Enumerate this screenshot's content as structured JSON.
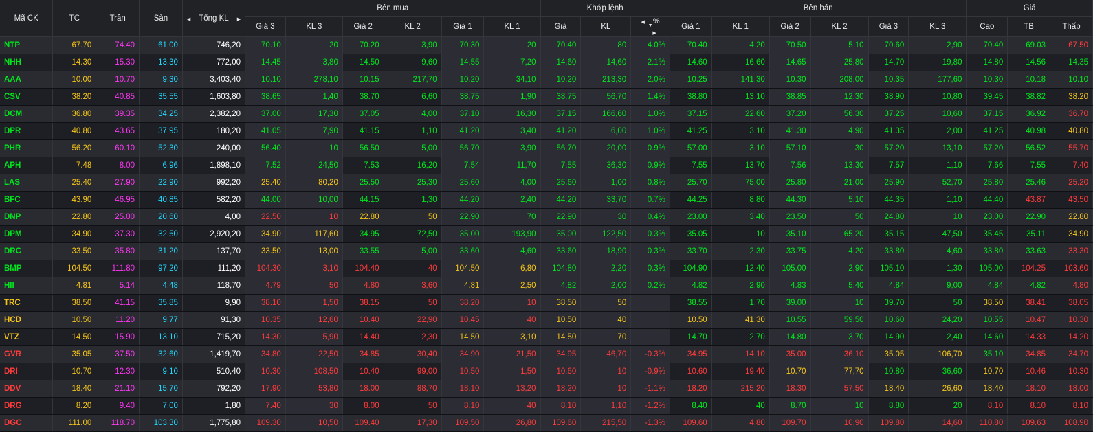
{
  "header": {
    "symbol": "Mã CK",
    "tc": "TC",
    "tran": "Trần",
    "san": "Sàn",
    "tongkl": "Tổng KL",
    "group_buy": "Bên mua",
    "group_match": "Khớp lệnh",
    "group_sell": "Bên bán",
    "group_price": "Giá",
    "buy_cols": [
      "Giá 3",
      "KL 3",
      "Giá 2",
      "KL 2",
      "Giá 1",
      "KL 1"
    ],
    "match_cols": [
      "Giá",
      "KL",
      "%"
    ],
    "sell_cols": [
      "Giá 1",
      "KL 1",
      "Giá 2",
      "KL 2",
      "Giá 3",
      "KL 3"
    ],
    "price_cols": [
      "Cao",
      "TB",
      "Thấp"
    ]
  },
  "colors": {
    "up": "#00e61e",
    "down": "#ff3b3b",
    "ref": "#f5c518",
    "ceil": "#ff37f5",
    "floor": "#1fd8ff"
  },
  "rows": [
    {
      "sym": "NTP",
      "s": "g",
      "tc": "67.70",
      "tran": "74.40",
      "san": "61.00",
      "kl": "746,20",
      "b3": [
        "70.10",
        "20",
        "g"
      ],
      "b2": [
        "70.20",
        "3,90",
        "g"
      ],
      "b1": [
        "70.30",
        "20",
        "g"
      ],
      "m": [
        "70.40",
        "80",
        "4.0%",
        "g"
      ],
      "s1": [
        "70.40",
        "4,20",
        "g"
      ],
      "s2": [
        "70.50",
        "5,10",
        "g"
      ],
      "s3": [
        "70.60",
        "2,90",
        "g"
      ],
      "hi": [
        "70.40",
        "g"
      ],
      "tb": [
        "69.03",
        "g"
      ],
      "lo": [
        "67.50",
        "r"
      ]
    },
    {
      "sym": "NHH",
      "s": "g",
      "tc": "14.30",
      "tran": "15.30",
      "san": "13.30",
      "kl": "772,00",
      "b3": [
        "14.45",
        "3,80",
        "g"
      ],
      "b2": [
        "14.50",
        "9,60",
        "g"
      ],
      "b1": [
        "14.55",
        "7,20",
        "g"
      ],
      "m": [
        "14.60",
        "14,60",
        "2.1%",
        "g"
      ],
      "s1": [
        "14.60",
        "16,60",
        "g"
      ],
      "s2": [
        "14.65",
        "25,80",
        "g"
      ],
      "s3": [
        "14.70",
        "19,80",
        "g"
      ],
      "hi": [
        "14.80",
        "g"
      ],
      "tb": [
        "14.56",
        "g"
      ],
      "lo": [
        "14.35",
        "g"
      ]
    },
    {
      "sym": "AAA",
      "s": "g",
      "tc": "10.00",
      "tran": "10.70",
      "san": "9.30",
      "kl": "3,403,40",
      "b3": [
        "10.10",
        "278,10",
        "g"
      ],
      "b2": [
        "10.15",
        "217,70",
        "g"
      ],
      "b1": [
        "10.20",
        "34,10",
        "g"
      ],
      "m": [
        "10.20",
        "213,30",
        "2.0%",
        "g"
      ],
      "s1": [
        "10.25",
        "141,30",
        "g"
      ],
      "s2": [
        "10.30",
        "208,00",
        "g"
      ],
      "s3": [
        "10.35",
        "177,60",
        "g"
      ],
      "hi": [
        "10.30",
        "g"
      ],
      "tb": [
        "10.18",
        "g"
      ],
      "lo": [
        "10.10",
        "g"
      ]
    },
    {
      "sym": "CSV",
      "s": "g",
      "tc": "38.20",
      "tran": "40.85",
      "san": "35.55",
      "kl": "1,603,80",
      "b3": [
        "38.65",
        "1,40",
        "g"
      ],
      "b2": [
        "38.70",
        "6,60",
        "g"
      ],
      "b1": [
        "38.75",
        "1,90",
        "g"
      ],
      "m": [
        "38.75",
        "56,70",
        "1.4%",
        "g"
      ],
      "s1": [
        "38.80",
        "13,10",
        "g"
      ],
      "s2": [
        "38.85",
        "12,30",
        "g"
      ],
      "s3": [
        "38.90",
        "10,80",
        "g"
      ],
      "hi": [
        "39.45",
        "g"
      ],
      "tb": [
        "38.82",
        "g"
      ],
      "lo": [
        "38.20",
        "y"
      ]
    },
    {
      "sym": "DCM",
      "s": "g",
      "tc": "36.80",
      "tran": "39.35",
      "san": "34.25",
      "kl": "2,382,20",
      "b3": [
        "37.00",
        "17,30",
        "g"
      ],
      "b2": [
        "37.05",
        "4,00",
        "g"
      ],
      "b1": [
        "37.10",
        "16,30",
        "g"
      ],
      "m": [
        "37.15",
        "166,60",
        "1.0%",
        "g"
      ],
      "s1": [
        "37.15",
        "22,60",
        "g"
      ],
      "s2": [
        "37.20",
        "56,30",
        "g"
      ],
      "s3": [
        "37.25",
        "10,60",
        "g"
      ],
      "hi": [
        "37.15",
        "g"
      ],
      "tb": [
        "36.92",
        "g"
      ],
      "lo": [
        "36.70",
        "r"
      ]
    },
    {
      "sym": "DPR",
      "s": "g",
      "tc": "40.80",
      "tran": "43.65",
      "san": "37.95",
      "kl": "180,20",
      "b3": [
        "41.05",
        "7,90",
        "g"
      ],
      "b2": [
        "41.15",
        "1,10",
        "g"
      ],
      "b1": [
        "41.20",
        "3,40",
        "g"
      ],
      "m": [
        "41.20",
        "6,00",
        "1.0%",
        "g"
      ],
      "s1": [
        "41.25",
        "3,10",
        "g"
      ],
      "s2": [
        "41.30",
        "4,90",
        "g"
      ],
      "s3": [
        "41.35",
        "2,00",
        "g"
      ],
      "hi": [
        "41.25",
        "g"
      ],
      "tb": [
        "40.98",
        "g"
      ],
      "lo": [
        "40.80",
        "y"
      ]
    },
    {
      "sym": "PHR",
      "s": "g",
      "tc": "56.20",
      "tran": "60.10",
      "san": "52.30",
      "kl": "240,00",
      "b3": [
        "56.40",
        "10",
        "g"
      ],
      "b2": [
        "56.50",
        "5,00",
        "g"
      ],
      "b1": [
        "56.70",
        "3,90",
        "g"
      ],
      "m": [
        "56.70",
        "20,00",
        "0.9%",
        "g"
      ],
      "s1": [
        "57.00",
        "3,10",
        "g"
      ],
      "s2": [
        "57.10",
        "30",
        "g"
      ],
      "s3": [
        "57.20",
        "13,10",
        "g"
      ],
      "hi": [
        "57.20",
        "g"
      ],
      "tb": [
        "56.52",
        "g"
      ],
      "lo": [
        "55.70",
        "r"
      ]
    },
    {
      "sym": "APH",
      "s": "g",
      "tc": "7.48",
      "tran": "8.00",
      "san": "6.96",
      "kl": "1,898,10",
      "b3": [
        "7.52",
        "24,50",
        "g"
      ],
      "b2": [
        "7.53",
        "16,20",
        "g"
      ],
      "b1": [
        "7.54",
        "11,70",
        "g"
      ],
      "m": [
        "7.55",
        "36,30",
        "0.9%",
        "g"
      ],
      "s1": [
        "7.55",
        "13,70",
        "g"
      ],
      "s2": [
        "7.56",
        "13,30",
        "g"
      ],
      "s3": [
        "7.57",
        "1,10",
        "g"
      ],
      "hi": [
        "7.66",
        "g"
      ],
      "tb": [
        "7.55",
        "g"
      ],
      "lo": [
        "7.40",
        "r"
      ]
    },
    {
      "sym": "LAS",
      "s": "g",
      "tc": "25.40",
      "tran": "27.90",
      "san": "22.90",
      "kl": "992,20",
      "b3": [
        "25.40",
        "80,20",
        "y"
      ],
      "b2": [
        "25.50",
        "25,30",
        "g"
      ],
      "b1": [
        "25.60",
        "4,00",
        "g"
      ],
      "m": [
        "25.60",
        "1,00",
        "0.8%",
        "g"
      ],
      "s1": [
        "25.70",
        "75,00",
        "g"
      ],
      "s2": [
        "25.80",
        "21,00",
        "g"
      ],
      "s3": [
        "25.90",
        "52,70",
        "g"
      ],
      "hi": [
        "25.80",
        "g"
      ],
      "tb": [
        "25.46",
        "g"
      ],
      "lo": [
        "25.20",
        "r"
      ]
    },
    {
      "sym": "BFC",
      "s": "g",
      "tc": "43.90",
      "tran": "46.95",
      "san": "40.85",
      "kl": "582,20",
      "b3": [
        "44.00",
        "10,00",
        "g"
      ],
      "b2": [
        "44.15",
        "1,30",
        "g"
      ],
      "b1": [
        "44.20",
        "2,40",
        "g"
      ],
      "m": [
        "44.20",
        "33,70",
        "0.7%",
        "g"
      ],
      "s1": [
        "44.25",
        "8,80",
        "g"
      ],
      "s2": [
        "44.30",
        "5,10",
        "g"
      ],
      "s3": [
        "44.35",
        "1,10",
        "g"
      ],
      "hi": [
        "44.40",
        "g"
      ],
      "tb": [
        "43.87",
        "r"
      ],
      "lo": [
        "43.50",
        "r"
      ]
    },
    {
      "sym": "DNP",
      "s": "g",
      "tc": "22.80",
      "tran": "25.00",
      "san": "20.60",
      "kl": "4,00",
      "b3": [
        "22.50",
        "10",
        "r"
      ],
      "b2": [
        "22.80",
        "50",
        "y"
      ],
      "b1": [
        "22.90",
        "70",
        "g"
      ],
      "m": [
        "22.90",
        "30",
        "0.4%",
        "g"
      ],
      "s1": [
        "23.00",
        "3,40",
        "g"
      ],
      "s2": [
        "23.50",
        "50",
        "g"
      ],
      "s3": [
        "24.80",
        "10",
        "g"
      ],
      "hi": [
        "23.00",
        "g"
      ],
      "tb": [
        "22.90",
        "g"
      ],
      "lo": [
        "22.80",
        "y"
      ]
    },
    {
      "sym": "DPM",
      "s": "g",
      "tc": "34.90",
      "tran": "37.30",
      "san": "32.50",
      "kl": "2,920,20",
      "b3": [
        "34.90",
        "117,60",
        "y"
      ],
      "b2": [
        "34.95",
        "72,50",
        "g"
      ],
      "b1": [
        "35.00",
        "193,90",
        "g"
      ],
      "m": [
        "35.00",
        "122,50",
        "0.3%",
        "g"
      ],
      "s1": [
        "35.05",
        "10",
        "g"
      ],
      "s2": [
        "35.10",
        "65,20",
        "g"
      ],
      "s3": [
        "35.15",
        "47,50",
        "g"
      ],
      "hi": [
        "35.45",
        "g"
      ],
      "tb": [
        "35.11",
        "g"
      ],
      "lo": [
        "34.90",
        "y"
      ]
    },
    {
      "sym": "DRC",
      "s": "g",
      "tc": "33.50",
      "tran": "35.80",
      "san": "31.20",
      "kl": "137,70",
      "b3": [
        "33.50",
        "13,00",
        "y"
      ],
      "b2": [
        "33.55",
        "5,00",
        "g"
      ],
      "b1": [
        "33.60",
        "4,60",
        "g"
      ],
      "m": [
        "33.60",
        "18,90",
        "0.3%",
        "g"
      ],
      "s1": [
        "33.70",
        "2,30",
        "g"
      ],
      "s2": [
        "33.75",
        "4,20",
        "g"
      ],
      "s3": [
        "33.80",
        "4,60",
        "g"
      ],
      "hi": [
        "33.80",
        "g"
      ],
      "tb": [
        "33.63",
        "g"
      ],
      "lo": [
        "33.30",
        "r"
      ]
    },
    {
      "sym": "BMP",
      "s": "g",
      "tc": "104.50",
      "tran": "111.80",
      "san": "97.20",
      "kl": "111,20",
      "b3": [
        "104.30",
        "3,10",
        "r"
      ],
      "b2": [
        "104.40",
        "40",
        "r"
      ],
      "b1": [
        "104.50",
        "6,80",
        "y"
      ],
      "m": [
        "104.80",
        "2,20",
        "0.3%",
        "g"
      ],
      "s1": [
        "104.90",
        "12,40",
        "g"
      ],
      "s2": [
        "105.00",
        "2,90",
        "g"
      ],
      "s3": [
        "105.10",
        "1,30",
        "g"
      ],
      "hi": [
        "105.00",
        "g"
      ],
      "tb": [
        "104.25",
        "r"
      ],
      "lo": [
        "103.60",
        "r"
      ]
    },
    {
      "sym": "HII",
      "s": "g",
      "tc": "4.81",
      "tran": "5.14",
      "san": "4.48",
      "kl": "118,70",
      "b3": [
        "4.79",
        "50",
        "r"
      ],
      "b2": [
        "4.80",
        "3,60",
        "r"
      ],
      "b1": [
        "4.81",
        "2,50",
        "y"
      ],
      "m": [
        "4.82",
        "2,00",
        "0.2%",
        "g"
      ],
      "s1": [
        "4.82",
        "2,90",
        "g"
      ],
      "s2": [
        "4.83",
        "5,40",
        "g"
      ],
      "s3": [
        "4.84",
        "9,00",
        "g"
      ],
      "hi": [
        "4.84",
        "g"
      ],
      "tb": [
        "4.82",
        "g"
      ],
      "lo": [
        "4.80",
        "r"
      ]
    },
    {
      "sym": "TRC",
      "s": "y",
      "tc": "38.50",
      "tran": "41.15",
      "san": "35.85",
      "kl": "9,90",
      "b3": [
        "38.10",
        "1,50",
        "r"
      ],
      "b2": [
        "38.15",
        "50",
        "r"
      ],
      "b1": [
        "38.20",
        "10",
        "r"
      ],
      "m": [
        "38.50",
        "50",
        "",
        "y"
      ],
      "s1": [
        "38.55",
        "1,70",
        "g"
      ],
      "s2": [
        "39.00",
        "10",
        "g"
      ],
      "s3": [
        "39.70",
        "50",
        "g"
      ],
      "hi": [
        "38.50",
        "y"
      ],
      "tb": [
        "38.41",
        "r"
      ],
      "lo": [
        "38.05",
        "r"
      ]
    },
    {
      "sym": "HCD",
      "s": "y",
      "tc": "10.50",
      "tran": "11.20",
      "san": "9.77",
      "kl": "91,30",
      "b3": [
        "10.35",
        "12,60",
        "r"
      ],
      "b2": [
        "10.40",
        "22,90",
        "r"
      ],
      "b1": [
        "10.45",
        "40",
        "r"
      ],
      "m": [
        "10.50",
        "40",
        "",
        "y"
      ],
      "s1": [
        "10.50",
        "41,30",
        "y"
      ],
      "s2": [
        "10.55",
        "59,50",
        "g"
      ],
      "s3": [
        "10.60",
        "24,20",
        "g"
      ],
      "hi": [
        "10.55",
        "g"
      ],
      "tb": [
        "10.47",
        "r"
      ],
      "lo": [
        "10.30",
        "r"
      ]
    },
    {
      "sym": "VTZ",
      "s": "y",
      "tc": "14.50",
      "tran": "15.90",
      "san": "13.10",
      "kl": "715,20",
      "b3": [
        "14.30",
        "5,90",
        "r"
      ],
      "b2": [
        "14.40",
        "2,30",
        "r"
      ],
      "b1": [
        "14.50",
        "3,10",
        "y"
      ],
      "m": [
        "14.50",
        "70",
        "",
        "y"
      ],
      "s1": [
        "14.70",
        "2,70",
        "g"
      ],
      "s2": [
        "14.80",
        "3,70",
        "g"
      ],
      "s3": [
        "14.90",
        "2,40",
        "g"
      ],
      "hi": [
        "14.60",
        "g"
      ],
      "tb": [
        "14.33",
        "r"
      ],
      "lo": [
        "14.20",
        "r"
      ]
    },
    {
      "sym": "GVR",
      "s": "r",
      "tc": "35.05",
      "tran": "37.50",
      "san": "32.60",
      "kl": "1,419,70",
      "b3": [
        "34.80",
        "22,50",
        "r"
      ],
      "b2": [
        "34.85",
        "30,40",
        "r"
      ],
      "b1": [
        "34.90",
        "21,50",
        "r"
      ],
      "m": [
        "34.95",
        "46,70",
        "-0.3%",
        "r"
      ],
      "s1": [
        "34.95",
        "14,10",
        "r"
      ],
      "s2": [
        "35.00",
        "36,10",
        "r"
      ],
      "s3": [
        "35.05",
        "106,70",
        "y"
      ],
      "hi": [
        "35.10",
        "g"
      ],
      "tb": [
        "34.85",
        "r"
      ],
      "lo": [
        "34.70",
        "r"
      ]
    },
    {
      "sym": "DRI",
      "s": "r",
      "tc": "10.70",
      "tran": "12.30",
      "san": "9.10",
      "kl": "510,40",
      "b3": [
        "10.30",
        "108,50",
        "r"
      ],
      "b2": [
        "10.40",
        "99,00",
        "r"
      ],
      "b1": [
        "10.50",
        "1,50",
        "r"
      ],
      "m": [
        "10.60",
        "10",
        "-0.9%",
        "r"
      ],
      "s1": [
        "10.60",
        "19,40",
        "r"
      ],
      "s2": [
        "10.70",
        "77,70",
        "y"
      ],
      "s3": [
        "10.80",
        "36,60",
        "g"
      ],
      "hi": [
        "10.70",
        "y"
      ],
      "tb": [
        "10.46",
        "r"
      ],
      "lo": [
        "10.30",
        "r"
      ]
    },
    {
      "sym": "DDV",
      "s": "r",
      "tc": "18.40",
      "tran": "21.10",
      "san": "15.70",
      "kl": "792,20",
      "b3": [
        "17.90",
        "53,80",
        "r"
      ],
      "b2": [
        "18.00",
        "88,70",
        "r"
      ],
      "b1": [
        "18.10",
        "13,20",
        "r"
      ],
      "m": [
        "18.20",
        "10",
        "-1.1%",
        "r"
      ],
      "s1": [
        "18.20",
        "215,20",
        "r"
      ],
      "s2": [
        "18.30",
        "57,50",
        "r"
      ],
      "s3": [
        "18.40",
        "26,60",
        "y"
      ],
      "hi": [
        "18.40",
        "y"
      ],
      "tb": [
        "18.10",
        "r"
      ],
      "lo": [
        "18.00",
        "r"
      ]
    },
    {
      "sym": "DRG",
      "s": "r",
      "tc": "8.20",
      "tran": "9.40",
      "san": "7.00",
      "kl": "1,80",
      "b3": [
        "7.40",
        "30",
        "r"
      ],
      "b2": [
        "8.00",
        "50",
        "r"
      ],
      "b1": [
        "8.10",
        "40",
        "r"
      ],
      "m": [
        "8.10",
        "1,10",
        "-1.2%",
        "r"
      ],
      "s1": [
        "8.40",
        "40",
        "g"
      ],
      "s2": [
        "8.70",
        "10",
        "g"
      ],
      "s3": [
        "8.80",
        "20",
        "g"
      ],
      "hi": [
        "8.10",
        "r"
      ],
      "tb": [
        "8.10",
        "r"
      ],
      "lo": [
        "8.10",
        "r"
      ]
    },
    {
      "sym": "DGC",
      "s": "r",
      "tc": "111.00",
      "tran": "118.70",
      "san": "103.30",
      "kl": "1,775,80",
      "b3": [
        "109.30",
        "10,50",
        "r"
      ],
      "b2": [
        "109.40",
        "17,30",
        "r"
      ],
      "b1": [
        "109.50",
        "26,80",
        "r"
      ],
      "m": [
        "109.60",
        "215,50",
        "-1.3%",
        "r"
      ],
      "s1": [
        "109.60",
        "4,80",
        "r"
      ],
      "s2": [
        "109.70",
        "10,90",
        "r"
      ],
      "s3": [
        "109.80",
        "14,60",
        "r"
      ],
      "hi": [
        "110.80",
        "r"
      ],
      "tb": [
        "109.63",
        "r"
      ],
      "lo": [
        "108.90",
        "r"
      ]
    }
  ]
}
